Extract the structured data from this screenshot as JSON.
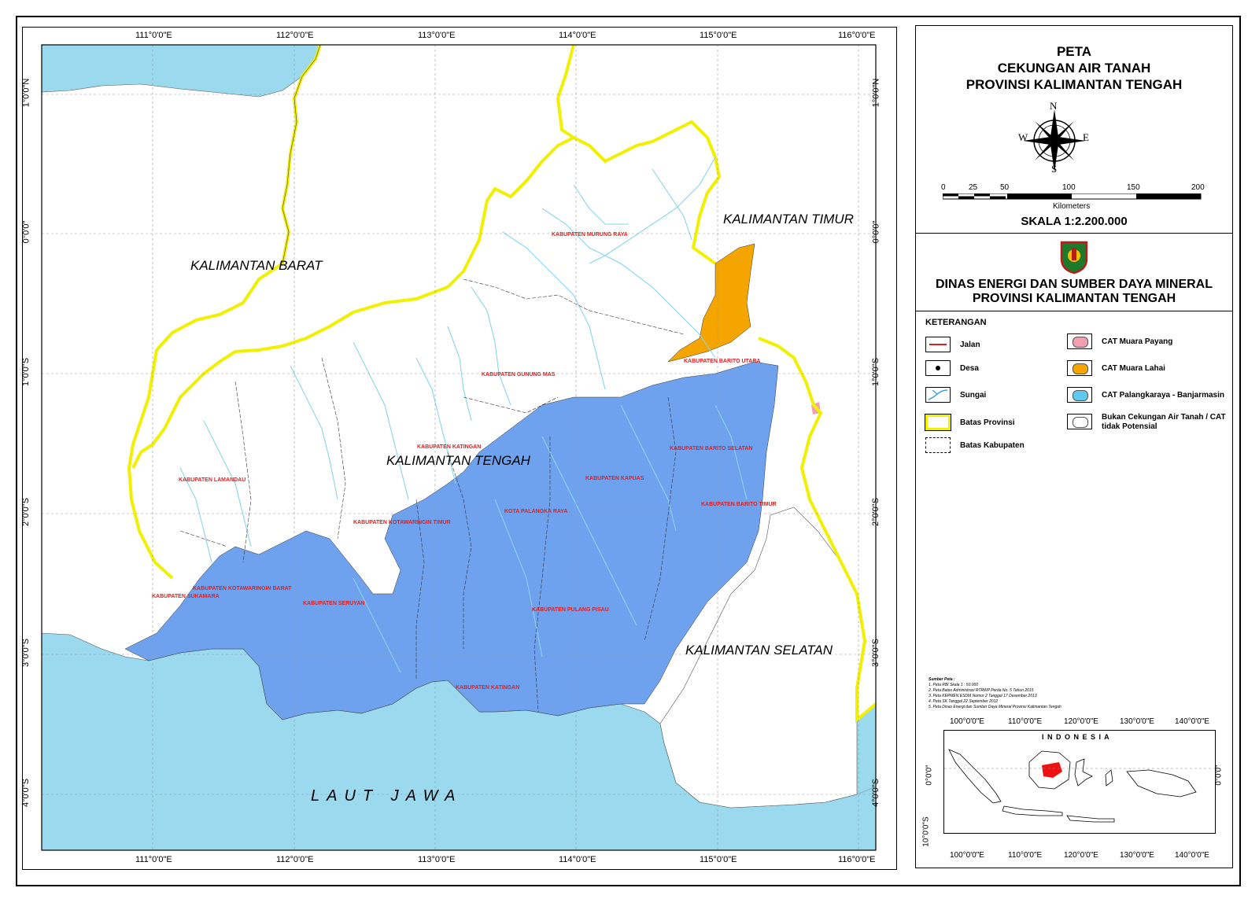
{
  "title": {
    "line1": "PETA",
    "line2": "CEKUNGAN AIR TANAH",
    "line3": "PROVINSI KALIMANTAN TENGAH"
  },
  "compass": {
    "n": "N",
    "s": "S",
    "e": "E",
    "w": "W"
  },
  "scalebar": {
    "ticks": [
      "0",
      "25",
      "50",
      "100",
      "150",
      "200"
    ],
    "unit": "Kilometers",
    "ratio": "SKALA  1:2.200.000"
  },
  "agency": {
    "line1": "DINAS ENERGI DAN SUMBER DAYA MINERAL",
    "line2": "PROVINSI KALIMANTAN TENGAH"
  },
  "legend": {
    "heading": "KETERANGAN",
    "items": [
      "Jalan",
      "Desa",
      "Sungai",
      "Batas Provinsi",
      "Batas Kabupaten"
    ],
    "cat_items": [
      "CAT Muara Payang",
      "CAT Muara Lahai",
      "CAT Palangkaraya - Banjarmasin",
      "Bukan Cekungan Air Tanah / CAT tidak Potensial"
    ]
  },
  "colors": {
    "sea": "#9ad9ee",
    "cat_palangkaraya": "#6fa2ee",
    "cat_muara_lahai": "#f5a500",
    "cat_muara_payang": "#f2a0b0",
    "province_border": "#f0f000",
    "river": "#8ad4f0",
    "kab_label": "#e02020",
    "inset_highlight": "#ee1111"
  },
  "grid": {
    "lon": [
      "111°0'0\"E",
      "112°0'0\"E",
      "113°0'0\"E",
      "114°0'0\"E",
      "115°0'0\"E",
      "116°0'0\"E"
    ],
    "lat": [
      "1°0'0\"N",
      "0°0'0\"",
      "1°0'0\"S",
      "2°0'0\"S",
      "3°0'0\"S",
      "4°0'0\"S"
    ]
  },
  "regions": {
    "barat": "KALIMANTAN BARAT",
    "timur": "KALIMANTAN TIMUR",
    "tengah": "KALIMANTAN TENGAH",
    "selatan": "KALIMANTAN SELATAN",
    "sea": "LAUT  JAWA"
  },
  "kabupaten": {
    "murung_raya": "KABUPATEN MURUNG RAYA",
    "barito_utara": "KABUPATEN BARITO UTARA",
    "gunung_mas": "KABUPATEN GUNUNG MAS",
    "katingan_n": "KABUPATEN KATINGAN",
    "barito_selatan": "KABUPATEN BARITO SELATAN",
    "lamandau": "KABUPATEN LAMANDAU",
    "kapuas": "KABUPATEN KAPUAS",
    "barito_timur": "KABUPATEN BARITO TIMUR",
    "palangka_raya": "KOTA PALANGKA RAYA",
    "kotim": "KABUPATEN KOTAWARINGIN TIMUR",
    "kobar": "KABUPATEN KOTAWARINGIN BARAT",
    "sukamara": "KABUPATEN SUKAMARA",
    "seruyan": "KABUPATEN SERUYAN",
    "pulang_pisau": "KABUPATEN PULANG PISAU",
    "katingan_s": "KABUPATEN KATINGAN"
  },
  "sources": {
    "heading": "Sumber Peta :",
    "lines": [
      "1. Peta RBI Skala 1 : 50.000",
      "2. Peta Batas Administrasi RTRWP Perda No. 5 Tahun 2015",
      "3. Peta KEPMEN ESDM Nomor 2 Tanggal 17 Desember 2013",
      "4. Peta SK Tanggal 22 September 2012",
      "5. Peta Dinas Energi dan Sumber Daya Mineral Provinsi Kalimantan Tengah"
    ]
  },
  "inset": {
    "label": "I N D O N E S I A",
    "lon": [
      "100°0'0\"E",
      "110°0'0\"E",
      "120°0'0\"E",
      "130°0'0\"E",
      "140°0'0\"E"
    ],
    "lat": [
      "0°0'0\"",
      "10°0'0\"S"
    ]
  }
}
